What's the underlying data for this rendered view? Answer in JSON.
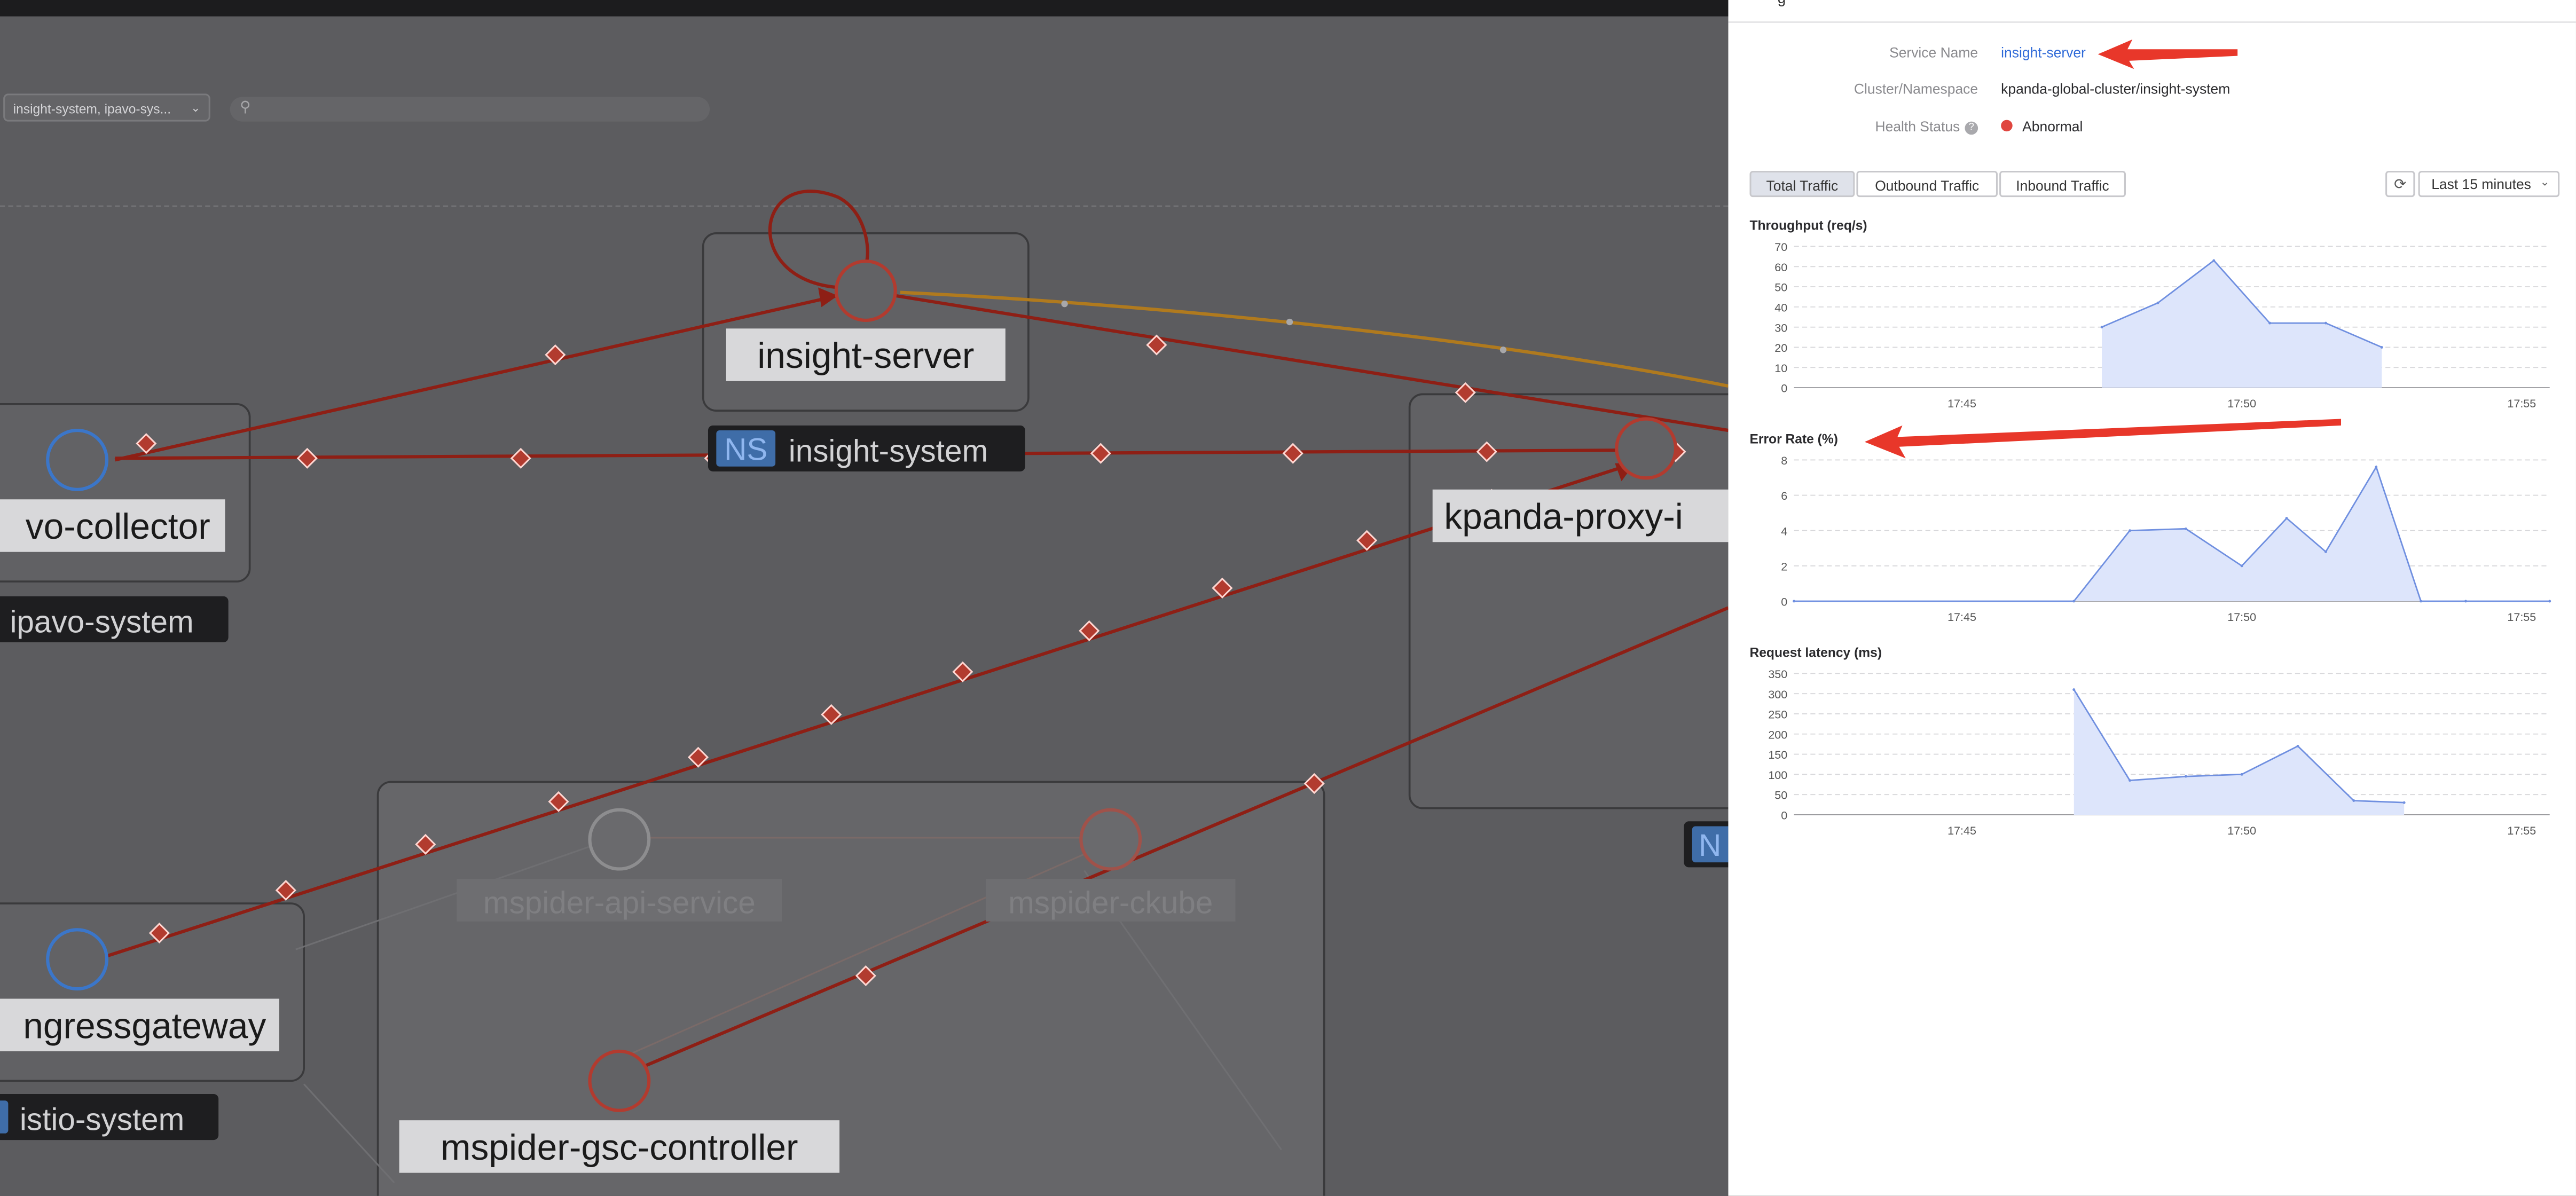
{
  "topology": {
    "filter": {
      "namespaces_value": "insight-system, ipavo-sys..."
    },
    "search": {
      "placeholder": ""
    },
    "services": [
      {
        "name": "insight-server",
        "color": "#b23b2f",
        "dim": false
      },
      {
        "name": "vo-collector",
        "color": "#3b76c9",
        "dim": false
      },
      {
        "name": "kpanda-proxy-i",
        "color": "#b23b2f",
        "dim": false
      },
      {
        "name": "ngressgateway",
        "color": "#3b76c9",
        "dim": false
      },
      {
        "name": "mspider-api-service",
        "color": "#8d8d8f",
        "dim": true
      },
      {
        "name": "mspider-ckube",
        "color": "#a0524a",
        "dim": true
      },
      {
        "name": "mspider-gsc-controller",
        "color": "#b23b2f",
        "dim": false
      }
    ],
    "namespaces": [
      {
        "badge": "NS",
        "name": "insight-system"
      },
      {
        "badge": "",
        "name": "ipavo-system"
      },
      {
        "badge": "",
        "name": "istio-system"
      },
      {
        "badge": "N",
        "name": ""
      }
    ]
  },
  "panel": {
    "service_name_label": "Service Name",
    "service_name_value": "insight-server",
    "cluster_label": "Cluster/Namespace",
    "cluster_value": "kpanda-global-cluster/insight-system",
    "health_label": "Health Status",
    "health_help_icon": "question-circle-icon",
    "health_value": "Abnormal",
    "health_color": "#e0463f",
    "tabs": [
      {
        "label": "Total Traffic",
        "active": true
      },
      {
        "label": "Outbound Traffic",
        "active": false
      },
      {
        "label": "Inbound Traffic",
        "active": false
      }
    ],
    "refresh_icon": "refresh-icon",
    "time_range": "Last 15 minutes"
  },
  "annotations": {
    "arrow_color": "#e8372a",
    "targets": [
      "service-name-value",
      "error-rate-title"
    ]
  },
  "chart_data": [
    {
      "type": "area",
      "title": "Throughput (req/s)",
      "ylim": [
        0,
        70
      ],
      "yticks": [
        "0",
        "10",
        "20",
        "30",
        "40",
        "50",
        "60",
        "70"
      ],
      "xticks": [
        "17:45",
        "17:50",
        "17:55"
      ],
      "xlim_minutes": [
        42,
        55.5
      ],
      "series": [
        {
          "x": [
            47.5,
            48.5,
            49.5,
            50.5,
            51.5,
            52.5
          ],
          "y": [
            30,
            42,
            63,
            32,
            32,
            20
          ]
        }
      ],
      "color": "#6f8fe0",
      "grid": true
    },
    {
      "type": "area",
      "title": "Error Rate (%)",
      "ylim": [
        0,
        8
      ],
      "yticks": [
        "0",
        "2",
        "4",
        "6",
        "8"
      ],
      "xticks": [
        "17:45",
        "17:50",
        "17:55"
      ],
      "xlim_minutes": [
        42,
        55.5
      ],
      "series": [
        {
          "x": [
            42,
            47.0,
            48.0,
            49.0,
            50.0,
            50.8,
            51.5,
            52.4,
            53.2,
            54,
            55.5
          ],
          "y": [
            0,
            0,
            4,
            4.1,
            2,
            4.7,
            2.8,
            7.6,
            0,
            0,
            0
          ]
        }
      ],
      "color": "#6f8fe0",
      "grid": true
    },
    {
      "type": "area",
      "title": "Request latency (ms)",
      "ylim": [
        0,
        350
      ],
      "yticks": [
        "0",
        "50",
        "100",
        "150",
        "200",
        "250",
        "300",
        "350"
      ],
      "xticks": [
        "17:45",
        "17:50",
        "17:55"
      ],
      "xlim_minutes": [
        42,
        55.5
      ],
      "series": [
        {
          "x": [
            47.0,
            48.0,
            49.0,
            50.0,
            51.0,
            52.0,
            52.9
          ],
          "y": [
            310,
            85,
            95,
            100,
            170,
            35,
            30
          ]
        }
      ],
      "color": "#6f8fe0",
      "grid": true
    }
  ]
}
